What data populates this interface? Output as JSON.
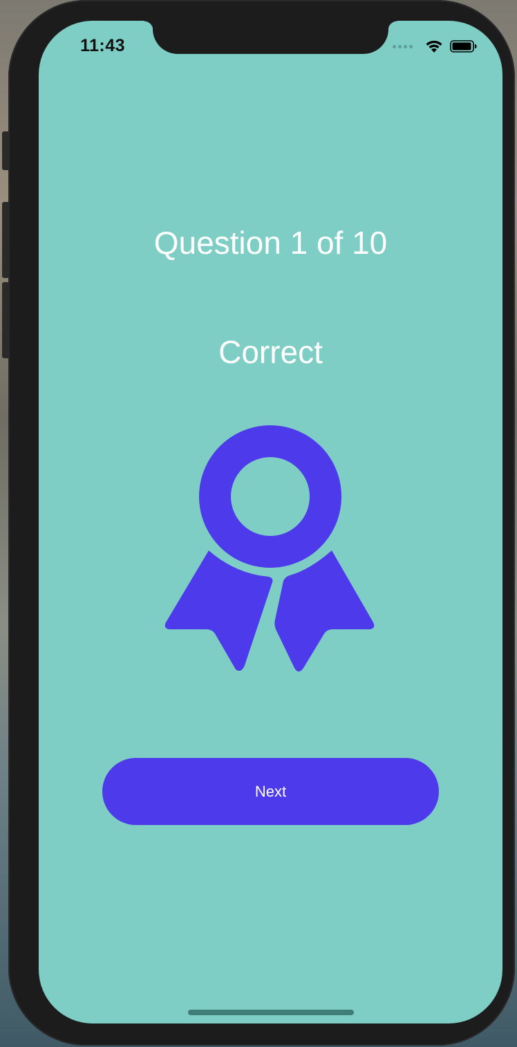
{
  "status_bar": {
    "time": "11:43",
    "icons": [
      "cellular-signal-icon",
      "wifi-icon",
      "battery-icon"
    ]
  },
  "quiz": {
    "progress_label": "Question 1 of 10",
    "result_label": "Correct",
    "result_icon": "award-ribbon-icon",
    "next_button_label": "Next"
  },
  "colors": {
    "background": "#7ecec5",
    "accent": "#4d3aea",
    "text": "#ffffff"
  }
}
